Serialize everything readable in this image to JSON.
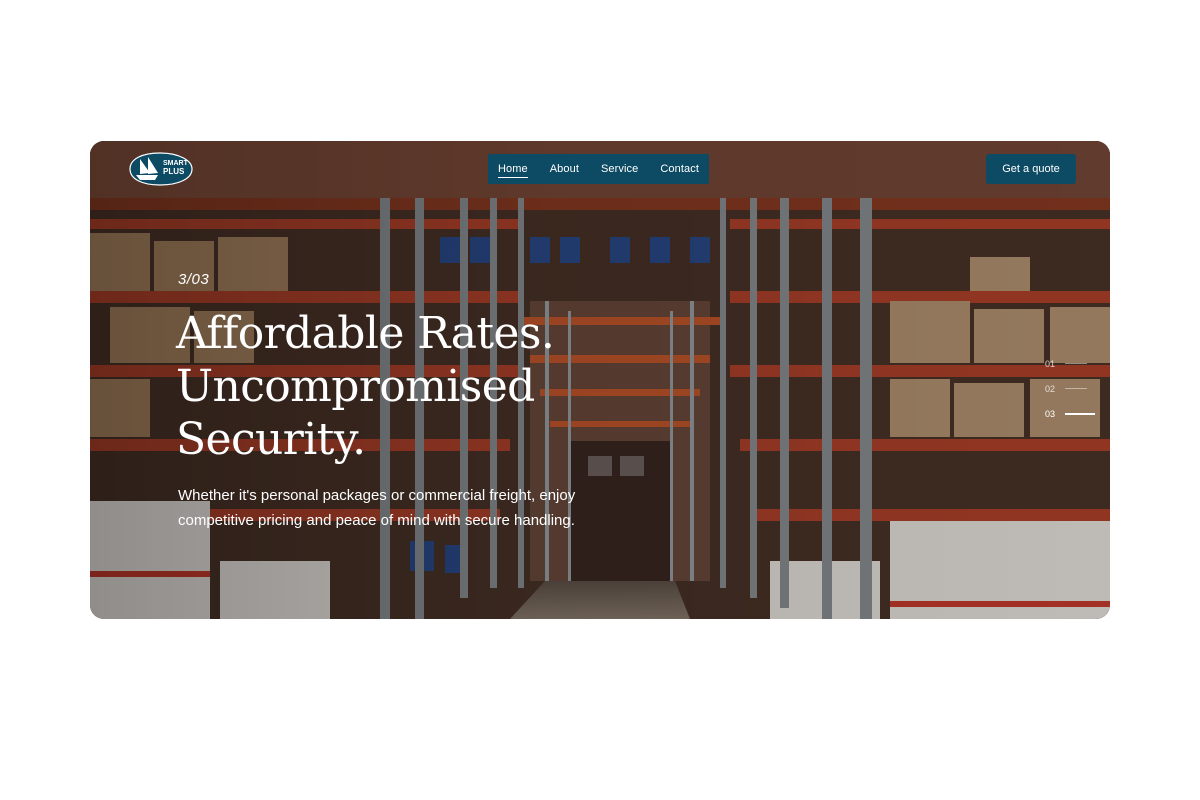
{
  "brand": {
    "logo_line1": "SMART",
    "logo_line2": "PLUS"
  },
  "nav": {
    "items": [
      {
        "label": "Home",
        "active": true
      },
      {
        "label": "About",
        "active": false
      },
      {
        "label": "Service",
        "active": false
      },
      {
        "label": "Contact",
        "active": false
      }
    ]
  },
  "cta": {
    "label": "Get a quote"
  },
  "hero": {
    "counter": "3/03",
    "headline": [
      "Affordable Rates.",
      "Uncompromised",
      "Security."
    ],
    "subtext": "Whether it's personal packages or commercial freight, enjoy competitive pricing and peace of mind with secure handling."
  },
  "slides": [
    {
      "label": "01",
      "active": false
    },
    {
      "label": "02",
      "active": false
    },
    {
      "label": "03",
      "active": true
    }
  ],
  "colors": {
    "accent": "#0d4a63",
    "text": "#ffffff",
    "page_bg": "#ffffff"
  }
}
